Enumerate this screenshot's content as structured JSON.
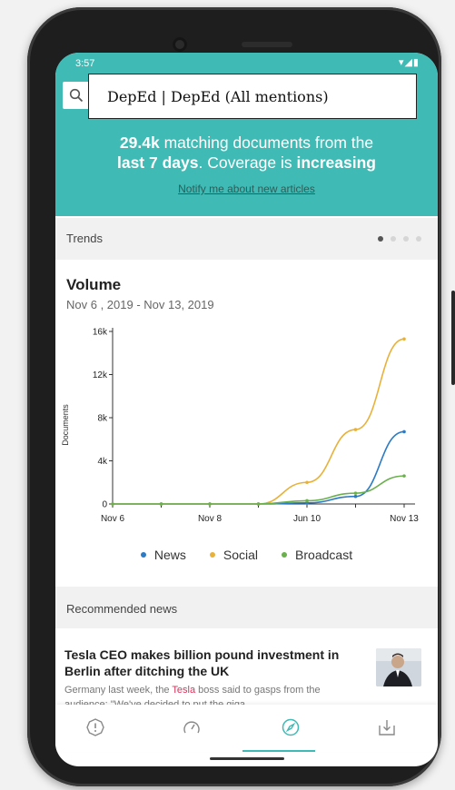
{
  "status": {
    "time": "3:57",
    "icons": "▾◢▮"
  },
  "search": {
    "query": "DepEd | DepEd (All mentions)"
  },
  "summary": {
    "count": "29.4k",
    "line1_rest": " matching documents from the",
    "period": "last 7 days",
    "line2_mid": ". Coverage is ",
    "trend": "increasing",
    "notify_link": "Notify me about new articles"
  },
  "trends": {
    "label": "Trends",
    "pages": 4,
    "active_page": 1
  },
  "volume": {
    "title": "Volume",
    "date_range": "Nov 6 , 2019 - Nov 13, 2019"
  },
  "chart_data": {
    "type": "line",
    "ylabel": "Documents",
    "ylim": [
      0,
      16000
    ],
    "y_ticks": [
      {
        "value": 0,
        "label": "0"
      },
      {
        "value": 4000,
        "label": "4k"
      },
      {
        "value": 8000,
        "label": "8k"
      },
      {
        "value": 12000,
        "label": "12k"
      },
      {
        "value": 16000,
        "label": "16k"
      }
    ],
    "x": [
      0,
      1,
      2,
      3,
      4,
      5,
      6
    ],
    "x_tick_labels": [
      {
        "x": 0,
        "label": "Nov 6"
      },
      {
        "x": 2,
        "label": "Nov 8"
      },
      {
        "x": 4,
        "label": "Jun 10"
      },
      {
        "x": 6,
        "label": "Nov 13"
      }
    ],
    "series": [
      {
        "name": "News",
        "color": "#2d7bc4",
        "values": [
          0,
          0,
          0,
          0,
          100,
          700,
          6700
        ]
      },
      {
        "name": "Social",
        "color": "#e8b13a",
        "values": [
          0,
          0,
          0,
          0,
          2000,
          6900,
          15300
        ]
      },
      {
        "name": "Broadcast",
        "color": "#6ab04c",
        "values": [
          0,
          0,
          0,
          0,
          300,
          1000,
          2600
        ]
      }
    ]
  },
  "recommended": {
    "label": "Recommended news",
    "article": {
      "title": "Tesla CEO makes billion pound investment in Berlin after ditching the UK",
      "snippet_before": "Germany last week, the ",
      "snippet_highlight": "Tesla",
      "snippet_after": " boss said to gasps from the audience: \"We've decided to put the giga"
    }
  },
  "nav": {
    "items": [
      {
        "icon": "alert-icon"
      },
      {
        "icon": "gauge-icon"
      },
      {
        "icon": "compass-icon",
        "active": true
      },
      {
        "icon": "download-icon"
      }
    ],
    "accent": "#3fbab5"
  }
}
